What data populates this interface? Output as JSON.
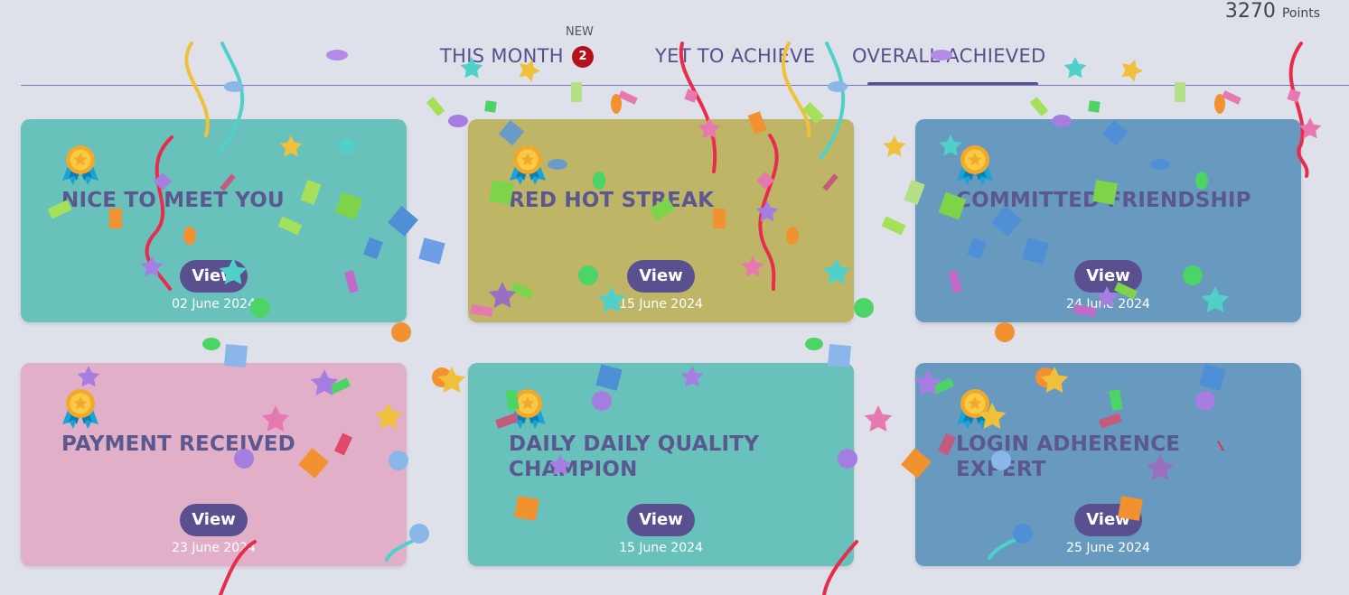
{
  "header": {
    "points_value": "3270",
    "points_label": "Points"
  },
  "tabs": [
    {
      "label": "THIS MONTH",
      "new_label": "NEW",
      "count": "2"
    },
    {
      "label": "YET TO ACHIEVE"
    },
    {
      "label": "OVERALL ACHIEVED",
      "active": true
    }
  ],
  "cards": [
    {
      "title": "NICE TO MEET YOU",
      "button": "View",
      "date": "02 June 2024",
      "color": "#68c2bb"
    },
    {
      "title": "RED HOT STREAK",
      "button": "View",
      "date": "15 June 2024",
      "color": "#bfb567"
    },
    {
      "title": "COMMITTED FRIENDSHIP",
      "button": "View",
      "date": "24 June 2024",
      "color": "#6899bf"
    },
    {
      "title": "PAYMENT RECEIVED",
      "button": "View",
      "date": "23 June 2024",
      "color": "#e2afc8"
    },
    {
      "title": "DAILY DAILY QUALITY CHAMPION",
      "button": "View",
      "date": "15 June 2024",
      "color": "#68c2bb"
    },
    {
      "title": "LOGIN ADHERENCE EXPERT",
      "button": "View",
      "date": "25 June 2024",
      "color": "#6899bf"
    }
  ],
  "icons": {
    "badge": "medal-icon"
  }
}
